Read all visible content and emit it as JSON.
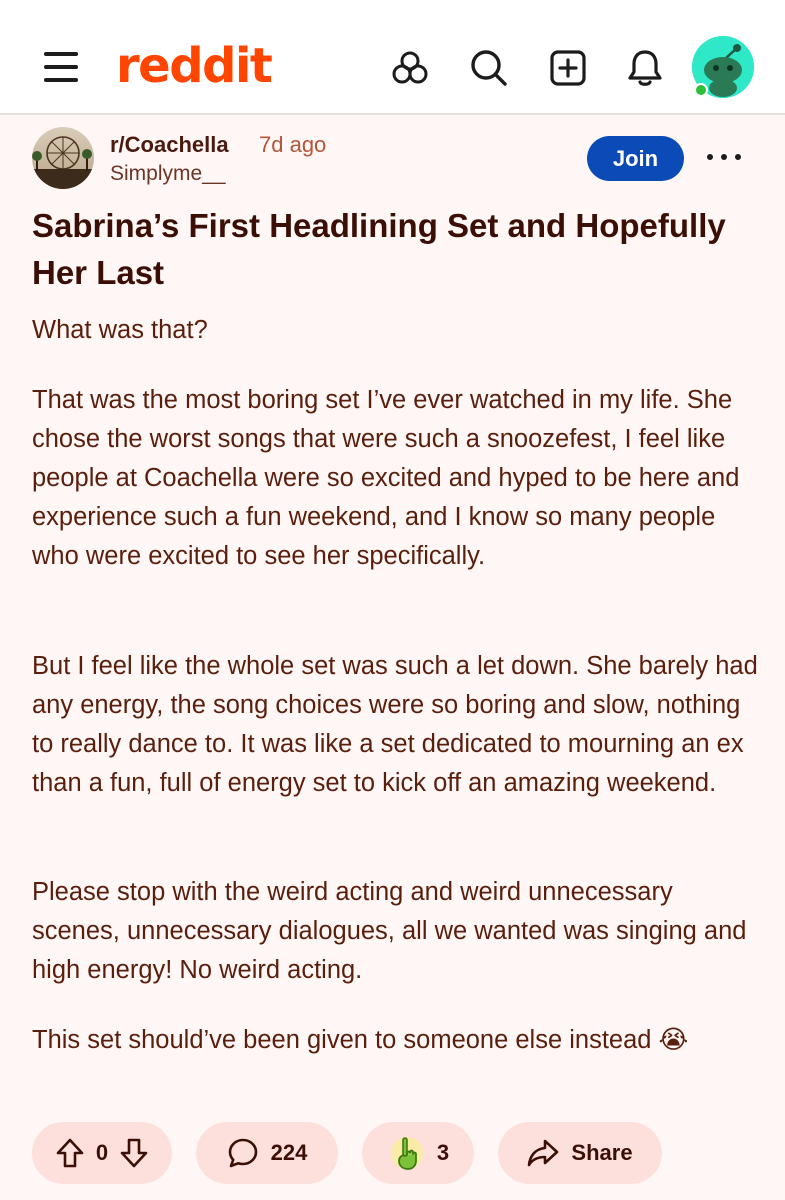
{
  "header": {
    "logo_text": "reddit",
    "icons": [
      "menu-icon",
      "popular-icon",
      "search-icon",
      "create-post-icon",
      "notifications-icon",
      "user-avatar"
    ]
  },
  "post": {
    "subreddit": "r/Coachella",
    "time_ago": "7d ago",
    "author": "Simplyme__",
    "join_label": "Join",
    "title": "Sabrina’s First Headlining Set and Hopefully Her Last",
    "paragraphs": [
      "What was that?",
      "That was the most boring set I’ve ever watched in my life. She chose the worst songs that were such a snoozefest, I feel like people at Coachella were so excited and hyped to be here and experience such a fun weekend, and I know so many people who were excited to see her specifically.",
      "But I feel like the whole set was such a let down. She barely had any energy, the song choices were so boring and slow, nothing to really dance to. It was like a set dedicated to mourning an ex than a fun, full of energy set to kick off an amazing weekend.",
      "Please stop with the weird acting and weird unnecessary scenes, unnecessary dialogues, all we wanted was singing and high energy! No weird acting.",
      "This set should’ve been given to someone else instead 😭"
    ]
  },
  "actions": {
    "votes": "0",
    "comments": "224",
    "awards": "3",
    "share_label": "Share"
  },
  "colors": {
    "brand": "#ff4500",
    "join": "#0a4bb8",
    "page_bg": "#fff7f6",
    "action_bg": "#fde0dc",
    "avatar_bg": "#2ee8c8"
  }
}
